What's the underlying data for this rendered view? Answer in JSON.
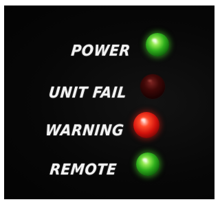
{
  "indicators": [
    {
      "label": "POWER",
      "state": "on",
      "color": "#3cc026"
    },
    {
      "label": "UNIT FAIL",
      "state": "off",
      "color": "#5a0a08"
    },
    {
      "label": "WARNING",
      "state": "on",
      "color": "#e0160e"
    },
    {
      "label": "REMOTE",
      "state": "on",
      "color": "#3cc026"
    }
  ]
}
